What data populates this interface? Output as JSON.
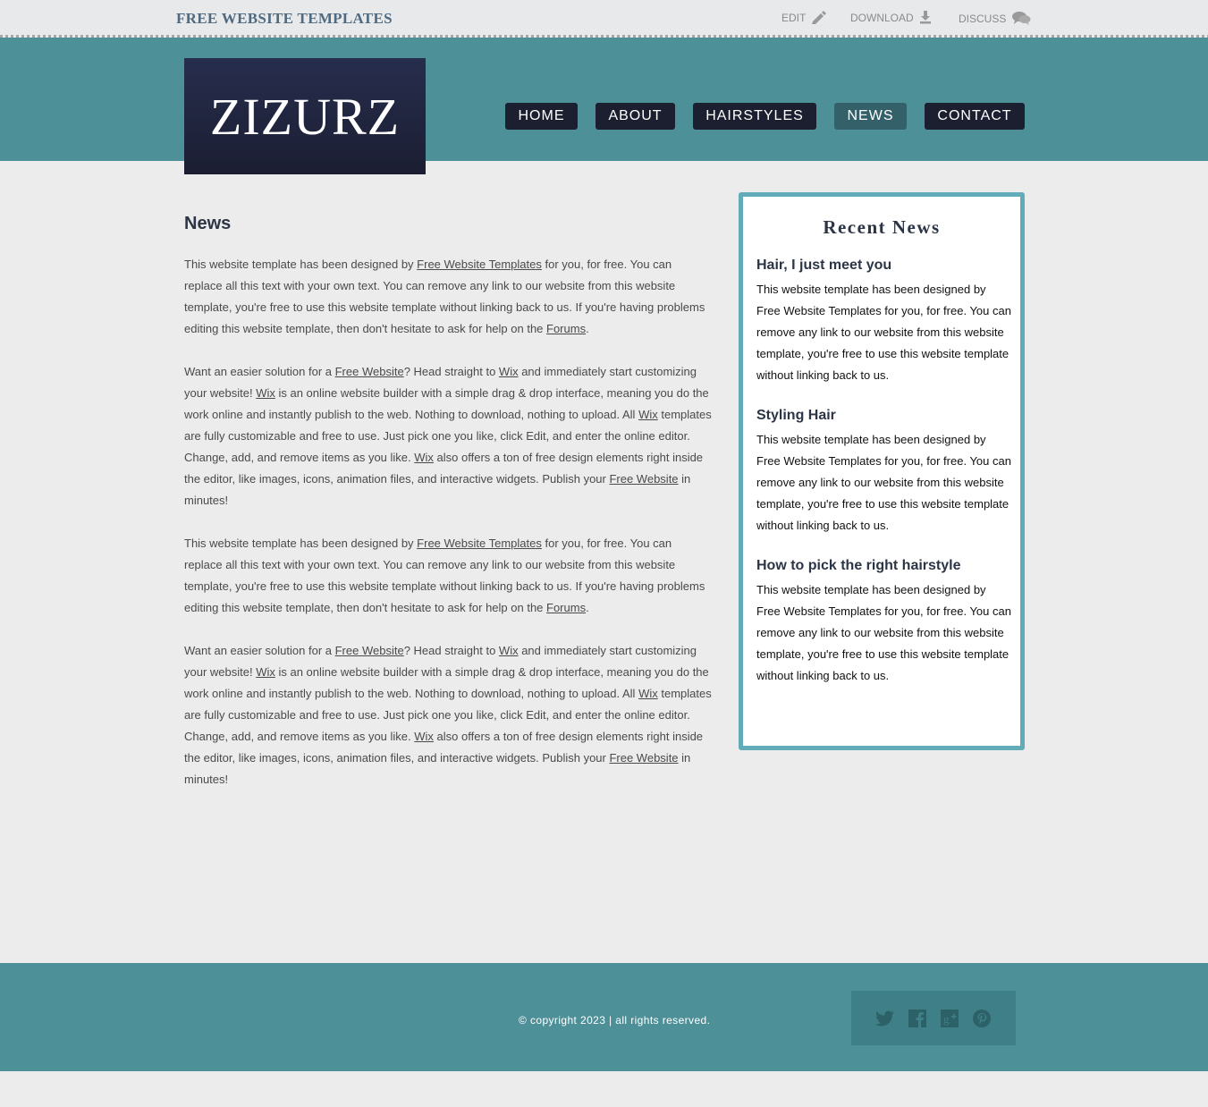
{
  "topbar": {
    "title": "FREE WEBSITE TEMPLATES",
    "links": [
      {
        "label": "EDIT",
        "icon": "pencil-icon"
      },
      {
        "label": "DOWNLOAD",
        "icon": "download-icon"
      },
      {
        "label": "DISCUSS",
        "icon": "speech-bubbles-icon"
      }
    ]
  },
  "header": {
    "logo": "ZIZURZ",
    "nav": [
      {
        "label": "HOME"
      },
      {
        "label": "ABOUT"
      },
      {
        "label": "HAIRSTYLES"
      },
      {
        "label": "NEWS",
        "active": true
      },
      {
        "label": "CONTACT"
      }
    ]
  },
  "main": {
    "title": "News",
    "p1": {
      "t1": "This website template has been designed by ",
      "l1": "Free Website Templates",
      "t2": " for you, for free. You can replace all this text with your own text. You can remove any link to our website from this website template, you're free to use this website template without linking back to us. If you're having problems editing this website template, then don't hesitate to ask for help on the ",
      "l2": "Forums",
      "t3": "."
    },
    "p2": {
      "t1": "Want an easier solution for a ",
      "l1": "Free Website",
      "t2": "? Head straight to ",
      "l2": "Wix",
      "t3": " and immediately start customizing your website! ",
      "l3": "Wix",
      "t4": " is an online website builder with a simple drag & drop interface, meaning you do the work online and instantly publish to the web. Nothing to download, nothing to upload. All ",
      "l4": "Wix",
      "t5": " templates are fully customizable and free to use. Just pick one you like, click Edit, and enter the online editor. Change, add, and remove items as you like. ",
      "l5": "Wix",
      "t6": " also offers a ton of free design elements right inside the editor, like images, icons, animation files, and interactive widgets. Publish your ",
      "l6": "Free Website",
      "t7": " in minutes!"
    }
  },
  "sidebar": {
    "title": "Recent News",
    "items": [
      {
        "title": "Hair, I just meet you",
        "body": "This website template has been designed by Free Website Templates for you, for free. You can remove any link to our website from this website template, you're free to use this website template without linking back to us."
      },
      {
        "title": "Styling Hair",
        "body": "This website template has been designed by Free Website Templates for you, for free. You can remove any link to our website from this website template, you're free to use this website template without linking back to us."
      },
      {
        "title": "How to pick the right hairstyle",
        "body": "This website template has been designed by Free Website Templates for you, for free. You can remove any link to our website from this website template, you're free to use this website template without linking back to us."
      }
    ]
  },
  "footer": {
    "copyright": "© copyright 2023 | all rights reserved.",
    "social": [
      "twitter-icon",
      "facebook-icon",
      "googleplus-icon",
      "pinterest-icon"
    ]
  },
  "colors": {
    "teal": "#4d9098",
    "navy": "#1c1f30",
    "active_nav": "#34606a",
    "sidebar_border": "#62abb8"
  }
}
